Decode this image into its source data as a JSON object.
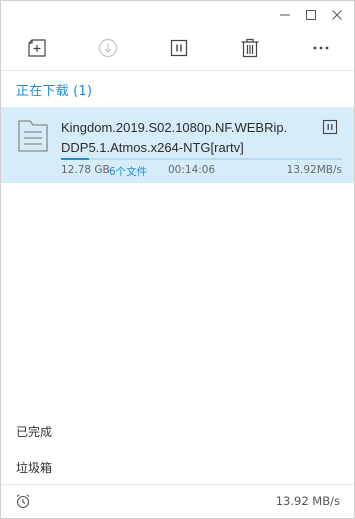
{
  "window": {
    "controls": [
      "minimize",
      "maximize",
      "close"
    ]
  },
  "toolbar": {
    "items": [
      {
        "name": "new-task",
        "icon": "new-task-icon"
      },
      {
        "name": "start",
        "icon": "download-arrow-icon",
        "disabled": true
      },
      {
        "name": "pause",
        "icon": "pause-icon"
      },
      {
        "name": "delete",
        "icon": "trash-icon"
      },
      {
        "name": "more",
        "icon": "more-dots-icon"
      }
    ]
  },
  "downloading": {
    "title": "正在下载 (1)"
  },
  "task": {
    "name_line1": "Kingdom.2019.S02.1080p.NF.WEBRip.",
    "name_line2": "DDP5.1.Atmos.x264-NTG[rartv]",
    "size": "12.78 GB",
    "files": "6个文件",
    "time_left": "00:14:06",
    "speed": "13.92MB/s",
    "progress": 0.1,
    "icon": "folder-icon"
  },
  "nav": {
    "completed": "已完成",
    "trash": "垃圾箱"
  },
  "status": {
    "speed": "13.92 MB/s",
    "icon": "alarm-clock-icon"
  },
  "colors": {
    "accent": "#1a8fd8",
    "task_bg": "#d6ecf9"
  }
}
